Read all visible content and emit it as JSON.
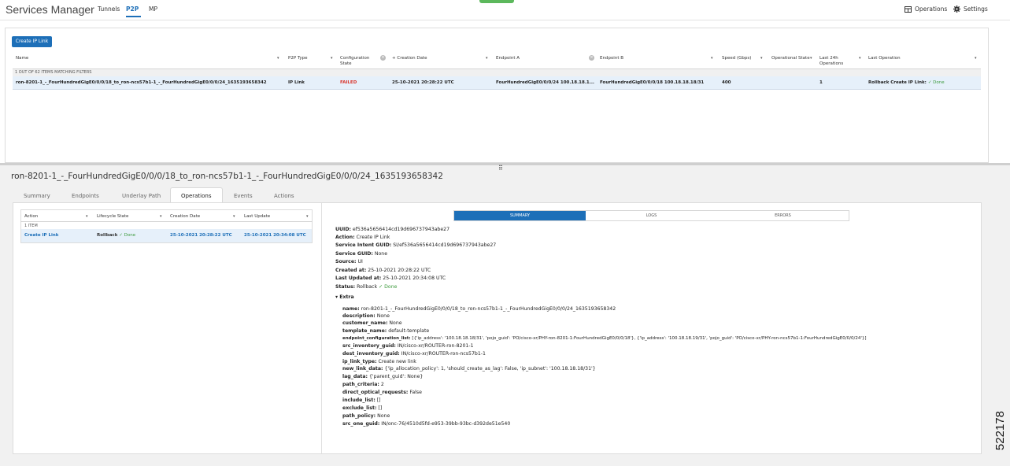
{
  "header": {
    "app_title": "Services Manager",
    "nav": [
      "Tunnels",
      "P2P",
      "MP"
    ],
    "active_nav": "P2P",
    "operations_label": "Operations",
    "settings_label": "Settings"
  },
  "top_table": {
    "create_button": "Create IP Link",
    "columns": [
      "Name",
      "P2P Type",
      "Configuration State",
      "+ Creation Date",
      "Endpoint A",
      "Endpoint B",
      "Speed (Gbps)",
      "Operational State",
      "Last 24h Operations",
      "Last Operation"
    ],
    "match_text": "1 OUT OF 62 ITEMS MATCHING FILTERS",
    "row": {
      "name": "ron-8201-1_-_FourHundredGigE0/0/0/18_to_ron-ncs57b1-1_-_FourHundredGigE0/0/0/24_1635193658342",
      "p2p_type": "IP Link",
      "config_state": "FAILED",
      "creation_date": "25-10-2021 20:28:22 UTC",
      "endpoint_a": "FourHundredGigE0/0/0/24 100.18.18.1...",
      "endpoint_b": "FourHundredGigE0/0/0/18 100.18.18.18/31",
      "speed": "400",
      "operational_state": "",
      "last_24h": "1",
      "last_operation": "Rollback Create IP Link:",
      "last_operation_status": "✓ Done"
    }
  },
  "detail": {
    "title": "ron-8201-1_-_FourHundredGigE0/0/0/18_to_ron-ncs57b1-1_-_FourHundredGigE0/0/0/24_1635193658342",
    "tabs": [
      "Summary",
      "Endpoints",
      "Underlay Path",
      "Operations",
      "Events",
      "Actions"
    ],
    "active_tab": "Operations"
  },
  "ops_table": {
    "columns": [
      "Action",
      "Lifecycle State",
      "Creation Date",
      "Last Update"
    ],
    "count": "1 ITEM",
    "row": {
      "action": "Create IP Link",
      "lifecycle": "Rollback",
      "lifecycle_status": "✓ Done",
      "creation_date": "25-10-2021 20:28:22 UTC",
      "last_update": "25-10-2021 20:34:08 UTC"
    }
  },
  "sub_tabs": [
    "SUMMARY",
    "LOGS",
    "ERRORS"
  ],
  "summary": [
    {
      "k": "UUID:",
      "v": " ef536a5656414cd19d696737943abe27"
    },
    {
      "k": "Action:",
      "v": " Create IP Link"
    },
    {
      "k": "Service Intent GUID:",
      "v": " SI/ef536a5656414cd19d696737943abe27"
    },
    {
      "k": "Service GUID:",
      "v": " None"
    },
    {
      "k": "Source:",
      "v": " UI"
    },
    {
      "k": "Created at:",
      "v": " 25-10-2021 20:28:22 UTC"
    },
    {
      "k": "Last Updated at:",
      "v": " 25-10-2021 20:34:08 UTC"
    },
    {
      "k": "Status:",
      "v": " Rollback",
      "status": " ✓ Done"
    }
  ],
  "extra_label": "▾ Extra",
  "extra": [
    {
      "k": "name:",
      "v": " ron-8201-1_-_FourHundredGigE0/0/0/18_to_ron-ncs57b1-1_-_FourHundredGigE0/0/0/24_1635193658342"
    },
    {
      "k": "description:",
      "v": " None"
    },
    {
      "k": "customer_name:",
      "v": " None"
    },
    {
      "k": "template_name:",
      "v": " default-template"
    },
    {
      "k": "endpoint_configuration_list:",
      "v": " [{'ip_address': '100.18.18.18/31', 'pojo_guid': 'PO/cisco-xr/PHY-ron-8201-1:FourHundredGigE0/0/0/18'}, {'ip_address': '100.18.18.19/31', 'pojo_guid': 'PO/cisco-xr/PHY-ron-ncs57b1-1:FourHundredGigE0/0/0/24'}]"
    },
    {
      "k": "src_inventory_guid:",
      "v": " IN/cisco-xr/ROUTER-ron-8201-1"
    },
    {
      "k": "dest_inventory_guid:",
      "v": " IN/cisco-xr/ROUTER-ron-ncs57b1-1"
    },
    {
      "k": "ip_link_type:",
      "v": " Create new link"
    },
    {
      "k": "new_link_data:",
      "v": " {'ip_allocation_policy': 1, 'should_create_as_lag': False, 'ip_subnet': '100.18.18.18/31'}"
    },
    {
      "k": "lag_data:",
      "v": " {'parent_guid': None}"
    },
    {
      "k": "path_criteria:",
      "v": " 2"
    },
    {
      "k": "direct_optical_requests:",
      "v": " False"
    },
    {
      "k": "include_list:",
      "v": " []"
    },
    {
      "k": "exclude_list:",
      "v": " []"
    },
    {
      "k": "path_policy:",
      "v": " None"
    },
    {
      "k": "src_one_guid:",
      "v": " IN/onc-76/4510d5fd-e953-39bb-93bc-d392de51e540"
    }
  ],
  "figure_id": "522178"
}
